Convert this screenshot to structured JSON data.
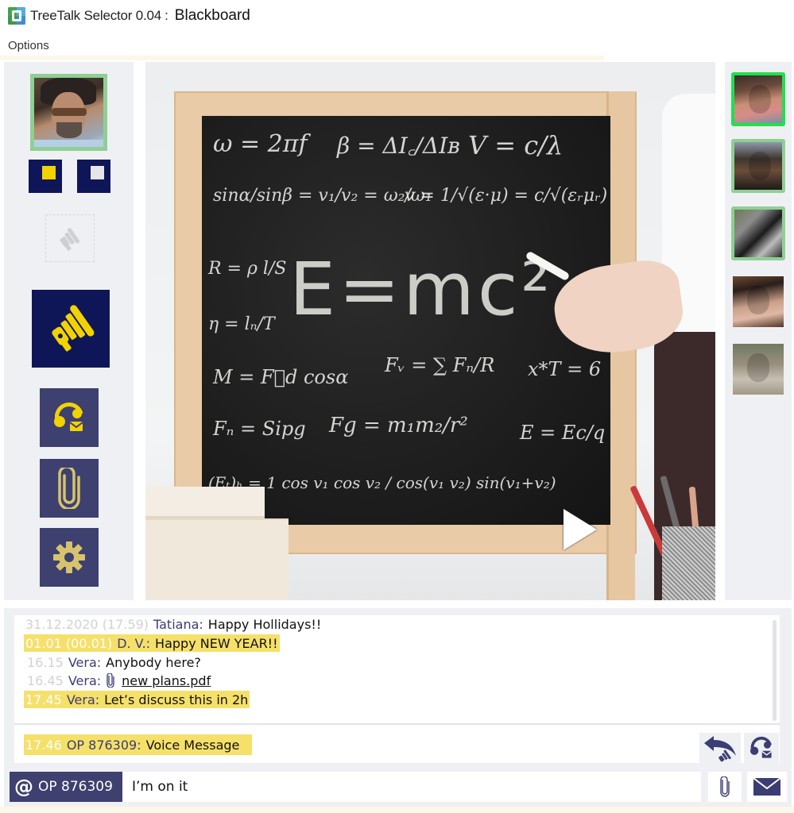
{
  "window": {
    "app_title": "TreeTalk Selector 0.04",
    "title_separator": ":",
    "document_title": "Blackboard",
    "app_icon": "treetalk-logo-icon"
  },
  "menu": {
    "items": [
      {
        "label": "Options"
      }
    ]
  },
  "left_toolbar": {
    "self_avatar": {
      "icon": "user-avatar",
      "status_color": "#8fcf94"
    },
    "toggles": [
      {
        "icon": "yellow-square-icon",
        "color": "#f2d200",
        "active": true
      },
      {
        "icon": "white-square-icon",
        "color": "#e6e6e8",
        "active": false
      }
    ],
    "disabled_button": {
      "icon": "megaphone-disabled-icon"
    },
    "push_to_talk": {
      "icon": "megaphone-icon",
      "bg": "#0f1657",
      "fg": "#f2d200"
    },
    "buttons": [
      {
        "name": "voicemail",
        "icon": "headset-mail-icon"
      },
      {
        "name": "attachments",
        "icon": "paperclip-icon"
      },
      {
        "name": "settings",
        "icon": "gear-icon"
      }
    ]
  },
  "main_view": {
    "content": "blackboard-video",
    "board_text": {
      "row1": [
        "ω = 2πf",
        "β = ΔI꜀/ΔIʙ",
        "V = c/λ"
      ],
      "row2": [
        "sinα/sinβ = v₁/v₂ = ω₂/ω₁",
        "v = 1/√(ε·μ) = c/√(εᵣμᵣ)"
      ],
      "left_col": [
        "R = ρ l/S",
        "η = lₙ/T",
        "M = F⃗d cosα"
      ],
      "big": "E=mc²",
      "row_mid": [
        "Fᵥ = ∑ Fₙ/R",
        "x*T = 6"
      ],
      "row_low": [
        "Fₙ = Sipg",
        "Fg = m₁m₂/r²",
        "E = Ec/q"
      ],
      "row_bottom": [
        "(Eₜ)ₕ = 1 cos v₁ cos v₂ / cos(v₁ v₂) sin(v₁+v₂)"
      ]
    },
    "play_button": {
      "icon": "play-icon"
    }
  },
  "contacts": [
    {
      "name": "contact-1",
      "status": "active"
    },
    {
      "name": "contact-2",
      "status": "online"
    },
    {
      "name": "contact-3",
      "status": "online"
    },
    {
      "name": "contact-4",
      "status": "offline"
    },
    {
      "name": "contact-5",
      "status": "offline"
    }
  ],
  "chat": {
    "messages": [
      {
        "time": "31.12.2020 (17.59)",
        "sender": "Tatiana:",
        "text": "Happy Hollidays!!",
        "highlight": false
      },
      {
        "time": "01.01 (00.01)",
        "sender": "D. V.:",
        "text": "Happy NEW YEAR!!",
        "highlight": true
      },
      {
        "time": "16.15",
        "sender": "Vera:",
        "text": "Anybody here?",
        "highlight": false
      },
      {
        "time": "16.45",
        "sender": "Vera:",
        "text": "new plans.pdf",
        "attachment": true,
        "highlight": false
      },
      {
        "time": "17.45",
        "sender": "Vera:",
        "text": "Let’s discuss this in 2h",
        "highlight": true
      }
    ],
    "pinned": {
      "time": "17.46",
      "sender": "OP 876309:",
      "text": "Voice Message",
      "highlight": true
    },
    "reply_button": {
      "icon": "reply-voice-icon"
    },
    "voice_reply_button": {
      "icon": "headset-mail-icon"
    },
    "highlight_color": "#f5e06a",
    "sender_color": "#3b3d73"
  },
  "composer": {
    "mention_symbol": "@",
    "mention_target": "OP 876309",
    "input_value": "I’m on it",
    "attach_icon": "paperclip-icon",
    "send_icon": "envelope-icon"
  }
}
